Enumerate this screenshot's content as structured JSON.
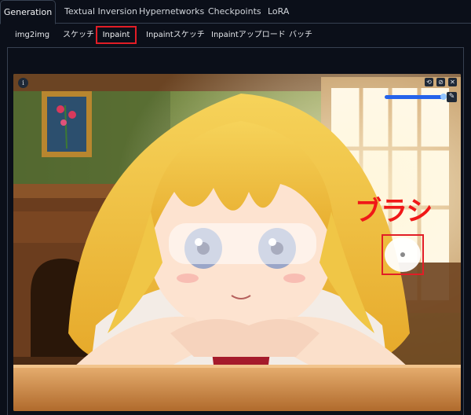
{
  "top_tabs": [
    {
      "label": "Generation",
      "active": true
    },
    {
      "label": "Textual Inversion",
      "active": false
    },
    {
      "label": "Hypernetworks",
      "active": false
    },
    {
      "label": "Checkpoints",
      "active": false
    },
    {
      "label": "LoRA",
      "active": false
    }
  ],
  "sub_tabs": [
    {
      "label": "img2img",
      "active": false
    },
    {
      "label": "スケッチ",
      "active": false
    },
    {
      "label": "Inpaint",
      "active": true
    },
    {
      "label": "Inpaintスケッチ",
      "active": false
    },
    {
      "label": "Inpaintアップロード",
      "active": false
    },
    {
      "label": "バッチ",
      "active": false
    }
  ],
  "canvas": {
    "info_icon": "info-icon",
    "toolbar_icons": [
      "undo-icon",
      "reset-icon",
      "close-icon"
    ],
    "toolbar_glyphs": [
      "⟲",
      "⊘",
      "✕"
    ],
    "info_glyph": "i",
    "brush_size_level": 0.95,
    "brush_button_icon": "brush-icon",
    "brush_button_glyph": "✎"
  },
  "annotation": {
    "label": "ブラシ",
    "color": "#f01818"
  },
  "colors": {
    "background": "#0b0f19",
    "border": "#374151",
    "highlight": "#e21d26",
    "slider": "#2563eb"
  }
}
